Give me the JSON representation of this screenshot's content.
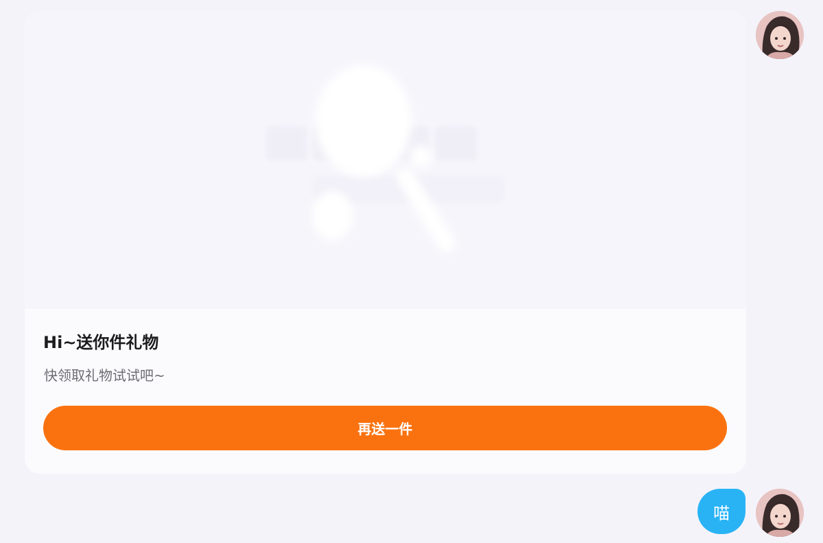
{
  "card": {
    "title": "Hi~送你件礼物",
    "subtitle": "快领取礼物试试吧~",
    "button_label": "再送一件"
  },
  "message": {
    "text": "喵"
  },
  "colors": {
    "background": "#f4f3fa",
    "card": "#fbfbfe",
    "button": "#fa7210",
    "bubble": "#29b3f5"
  }
}
